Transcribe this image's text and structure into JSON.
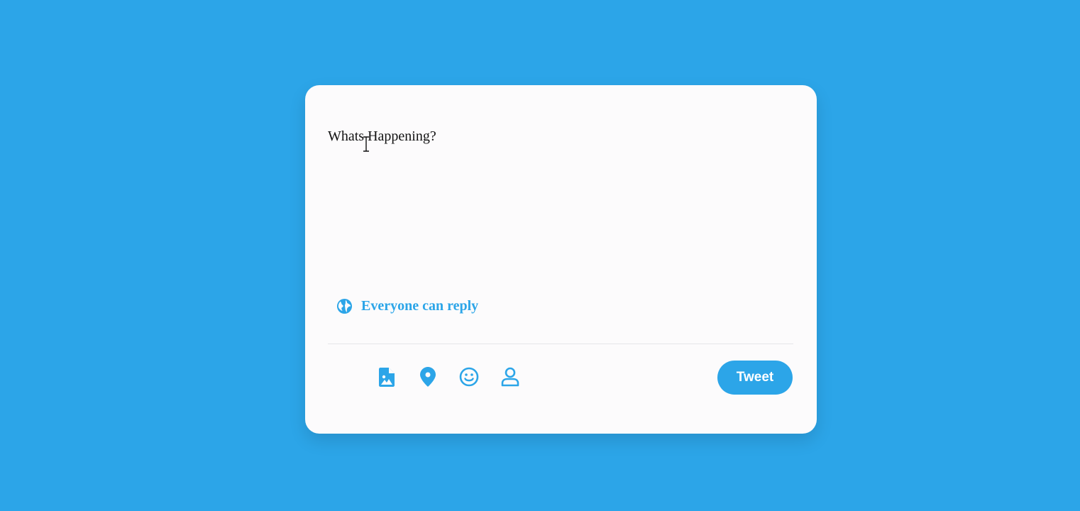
{
  "compose": {
    "placeholder": "Whats Happening?"
  },
  "reply_setting": {
    "label": "Everyone can reply",
    "icon": "globe-icon"
  },
  "toolbar": {
    "icons": [
      "image-file-icon",
      "location-pin-icon",
      "smiley-icon",
      "user-icon"
    ],
    "tweet_label": "Tweet"
  },
  "colors": {
    "background": "#2ca5e8",
    "card": "#fcfbfc",
    "accent": "#2ca5e8",
    "text": "#111111",
    "divider": "#e6e6e9"
  }
}
